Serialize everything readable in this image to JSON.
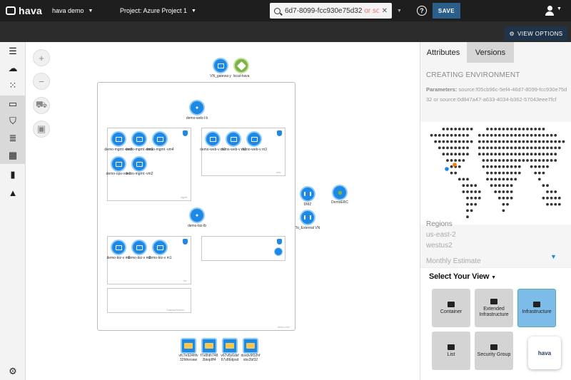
{
  "topbar": {
    "logo": "hava",
    "workspace": "hava demo",
    "project": "Project: Azure Project 1",
    "search_value": "6d7-8099-fcc930e75d32",
    "search_or": "or so",
    "help": "?",
    "save": "SAVE"
  },
  "subbar": {
    "view_options": "VIEW OPTIONS"
  },
  "leftnav": {
    "items": [
      "menu-icon",
      "cloud-upload-icon",
      "apps-icon",
      "laptop-icon",
      "shield-icon",
      "list-icon",
      "table-icon",
      "bar-chart-icon",
      "warning-icon"
    ],
    "settings": "gear-icon"
  },
  "zoom": {
    "in": "+",
    "out": "−"
  },
  "diagram": {
    "top_nodes": [
      {
        "label": "VN_gatewa y"
      },
      {
        "label": "local-hava"
      }
    ],
    "lb_web": "demo-web-l b",
    "lb_biz": "demo-biz-lb",
    "mgmt_vms": [
      "demo-mgmt -vm3",
      "demo-mgmt -vm1",
      "demo-mgmt -vm4",
      "demo-ops-v m1",
      "demo-mgmt -vm2"
    ],
    "web_vms": [
      "demo-web-v m2",
      "demo-web-v m1",
      "demo-web-v m3"
    ],
    "biz_vms": [
      "demo-biz-v m2",
      "demo-biz-v m3",
      "demo-biz-v m1"
    ],
    "side_nodes": [
      {
        "label": "DMZ"
      },
      {
        "label": "DemoERC"
      },
      {
        "label": "To_External VN"
      }
    ],
    "storage": [
      "vfc7e924hfv 32fdnosaw",
      "f7v8hth748 2bkqdff4",
      "v67v8y6dsf 67v86dpsd",
      "dsvdv9f32hf sbv2bf32"
    ],
    "subnet_tags": [
      "mgmt",
      "web",
      "biz",
      "GatewaySubnet",
      "demo-vnet"
    ]
  },
  "panel": {
    "tabs": [
      "Attributes",
      "Versions"
    ],
    "title": "CREATING ENVIRONMENT",
    "params_label": "Parameters:",
    "params_value": " source:f05cb96c-5ef4-46d7-8099-fcc930e75d32 or source:0d847a47-a633-4034-b362-57043eee7fcf",
    "regions_label": "Regions",
    "regions": [
      "us-east-2",
      "westus2"
    ],
    "monthly": "Monthly Estimate",
    "select_view": "Select Your View",
    "views": [
      {
        "label": "Container",
        "selected": false
      },
      {
        "label": "Extended Infrastructure",
        "selected": false
      },
      {
        "label": "Infrastructure",
        "selected": true
      },
      {
        "label": "List",
        "selected": false
      },
      {
        "label": "Security Group",
        "selected": false
      }
    ],
    "chat_logo": "hava"
  }
}
